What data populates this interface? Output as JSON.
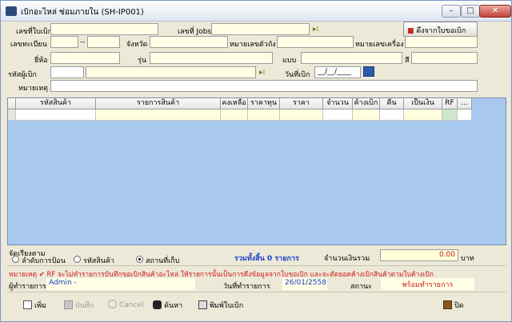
{
  "window": {
    "title": "เบิกอะไหล่ ซ่อมภายใน (SH-IP001)"
  },
  "header": {
    "doc_no_label": "เลขที่ใบเบิก",
    "job_no_label": "เลขที่ Jobs",
    "pull_btn_label": "ดึงจากใบขอเบิก",
    "plate_label": "เลขทะเบียน",
    "plate_sep": "--",
    "province_label": "จังหวัด",
    "body_no_label": "หมายเลขตัวถัง",
    "engine_no_label": "หมายเลขเครื่อง",
    "brand_label": "ยี่ห้อ",
    "model_label": "รุ่น",
    "type_label": "แบบ",
    "color_label": "สี",
    "requester_label": "รหัสผู้เบิก",
    "request_date_label": "วันที่เบิก",
    "request_date_value": "__/__/____",
    "remark_label": "หมายเหตุ"
  },
  "grid": {
    "columns": [
      "รหัสสินค้า",
      "รายการสินค้า",
      "คงเหลือ",
      "ราคาทุน",
      "ราคา",
      "จำนวน",
      "ค้างเบิก",
      "คืน",
      "เป็นเงิน",
      "RF",
      "..."
    ]
  },
  "sort": {
    "label": "จัดเรียงตาม",
    "options": [
      "ลำดับการป้อน",
      "รหัสสินค้า",
      "สถานที่เก็บ"
    ],
    "selected": "สถานที่เก็บ"
  },
  "summary": {
    "total_items_text": "รวมทั้งสิ้น 0 รายการ",
    "amount_label": "จำนวนเงินรวม",
    "amount_value": "0.00",
    "currency": "บาท"
  },
  "note": "หมายเหตุ ✔ RF จะไม่ทำรายการบันทึกขอเบิกสินค้าอะไหล่  ให้รายการนั้นเป็นการดึงข้อมูลจากใบขอเบิก และจะตัดยอดค้างเบิกสินค้าตามใบค้างเบิก",
  "footer": {
    "operator_label": "ผู้ทำรายการ",
    "operator_value": "Admin -",
    "txn_date_label": "วันที่ทำรายการ",
    "txn_date_value": "26/01/2558",
    "status_label": "สถานะ",
    "status_value": "พร้อมทำรายการ"
  },
  "toolbar": {
    "new": "เพิ่ม",
    "save": "บันทึก",
    "cancel": "Cancel",
    "find": "ค้นหา",
    "print": "พิมพ์ใบเบิก",
    "close": "ปิด"
  }
}
